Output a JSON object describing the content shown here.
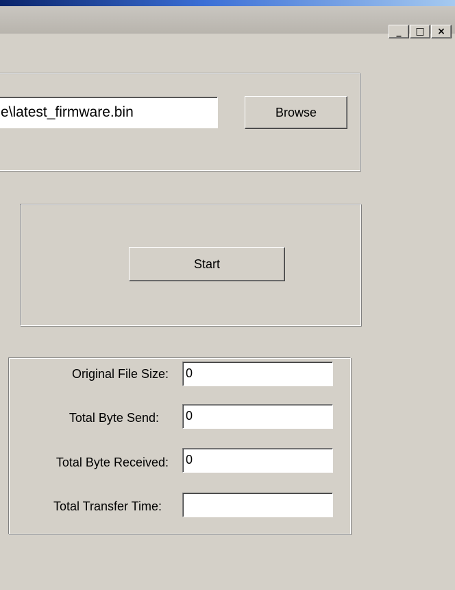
{
  "window": {
    "controls": {
      "minimize": "_",
      "maximize": "□",
      "close": "×"
    }
  },
  "file": {
    "path_value": "e\\latest_firmware.bin",
    "browse_label": "Browse"
  },
  "transfer": {
    "start_label": "Start"
  },
  "stats": {
    "original_file_size_label": "Original File Size:",
    "original_file_size_value": "0",
    "total_byte_send_label": "Total Byte Send:",
    "total_byte_send_value": "0",
    "total_byte_received_label": "Total Byte Received:",
    "total_byte_received_value": "0",
    "total_transfer_time_label": "Total Transfer Time:",
    "total_transfer_time_value": ""
  },
  "colors": {
    "face": "#d4d0c8",
    "titlebar_gradient_start": "#0a246a",
    "titlebar_gradient_end": "#a6caf0"
  }
}
